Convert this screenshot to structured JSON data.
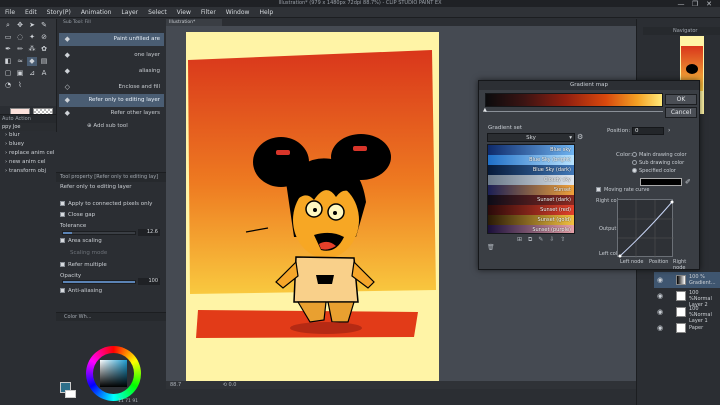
{
  "window": {
    "title": "Illustration* (979 x 1480px 72dpi 88.7%) - CLIP STUDIO PAINT EX",
    "controls": [
      "—",
      "❐",
      "✕"
    ]
  },
  "menu": [
    "File",
    "Edit",
    "Story(P)",
    "Animation",
    "Layer",
    "Select",
    "View",
    "Filter",
    "Window",
    "Help"
  ],
  "document_tab": "Illustration*",
  "subtool": {
    "header": "Sub Tool: Fill",
    "items": [
      {
        "label": "Paint unfilled are",
        "selected": true
      },
      {
        "label": "one layer",
        "selected": false
      },
      {
        "label": "aliasing",
        "selected": false
      },
      {
        "label": "Enclose and fill",
        "selected": false
      },
      {
        "label": "Refer only to editing layer",
        "selected": true
      },
      {
        "label": "Refer other layers",
        "selected": false
      }
    ],
    "add_label": "Add sub tool"
  },
  "auto_action": {
    "header": "Auto Action",
    "dropdown": "ppy Joe",
    "items": [
      "blur",
      "bluey",
      "replace anim cel",
      "new anim cel",
      "transform obj"
    ]
  },
  "tool_property": {
    "header": "Tool property [Refer only to editing lay]",
    "title": "Refer only to editing layer",
    "apply_connected": "Apply to connected pixels only",
    "close_gap": "Close gap",
    "tolerance_label": "Tolerance",
    "tolerance_value": "12.6",
    "tolerance_fraction": 0.126,
    "area_scaling": "Area scaling",
    "scaling_mode": "Scaling mode",
    "refer_multiple": "Refer multiple",
    "opacity_label": "Opacity",
    "opacity_value": "100",
    "opacity_fraction": 1.0,
    "anti_aliasing": "Anti-aliasing"
  },
  "color_panel": {
    "header": "Color Wh...",
    "status_values": "11  71  91",
    "fg_color": "#2e6f8a",
    "bg_color": "#ffffff"
  },
  "canvas_status": {
    "zoom": "88.7",
    "rotation": "0.0"
  },
  "navigator": {
    "header": "Navigator"
  },
  "layers": [
    {
      "name": "Gradient...",
      "blend": "100 %",
      "selected": true
    },
    {
      "name": "Layer 2",
      "blend": "100 %Normal",
      "selected": false
    },
    {
      "name": "Layer 1",
      "blend": "100 %Normal",
      "selected": false
    },
    {
      "name": "Paper",
      "blend": "",
      "selected": false
    }
  ],
  "gradient_dialog": {
    "title": "Gradient map",
    "ok": "OK",
    "cancel": "Cancel",
    "set_label": "Gradient set",
    "set_selected": "Sky",
    "presets": [
      {
        "name": "Blue sky",
        "from": "#0e2a6b",
        "to": "#6fb4f2"
      },
      {
        "name": "Blue Sky (bright)",
        "from": "#1f6fc7",
        "to": "#b8e3ff"
      },
      {
        "name": "Blue Sky (dark)",
        "from": "#061a3a",
        "to": "#4178b8"
      },
      {
        "name": "Cloudy sky",
        "from": "#6b7a8a",
        "to": "#dfe6ee"
      },
      {
        "name": "Sunset",
        "from": "#1b1f55",
        "to": "#f0a13a"
      },
      {
        "name": "Sunset (dark)",
        "from": "#0c0c18",
        "to": "#8a2a22"
      },
      {
        "name": "Sunset (red)",
        "from": "#2a0a0a",
        "to": "#e2402a"
      },
      {
        "name": "Sunset (gold)",
        "from": "#2a1a06",
        "to": "#f2c040"
      },
      {
        "name": "Sunset (purple)",
        "from": "#1a0f3a",
        "to": "#e6a0a8"
      }
    ],
    "position_label": "Position:",
    "position_value": "0",
    "color_label": "Color:",
    "color_options": [
      {
        "label": "Main drawing color",
        "on": false
      },
      {
        "label": "Sub drawing color",
        "on": false
      },
      {
        "label": "Specified color",
        "on": true
      }
    ],
    "moving_rate_curve": "Moving rate curve",
    "right_color": "Right color",
    "output_label": "Output",
    "left_color": "Left color",
    "left_node": "Left node",
    "position_axis": "Position",
    "right_node": "Right node",
    "specified_color": "#000000"
  }
}
